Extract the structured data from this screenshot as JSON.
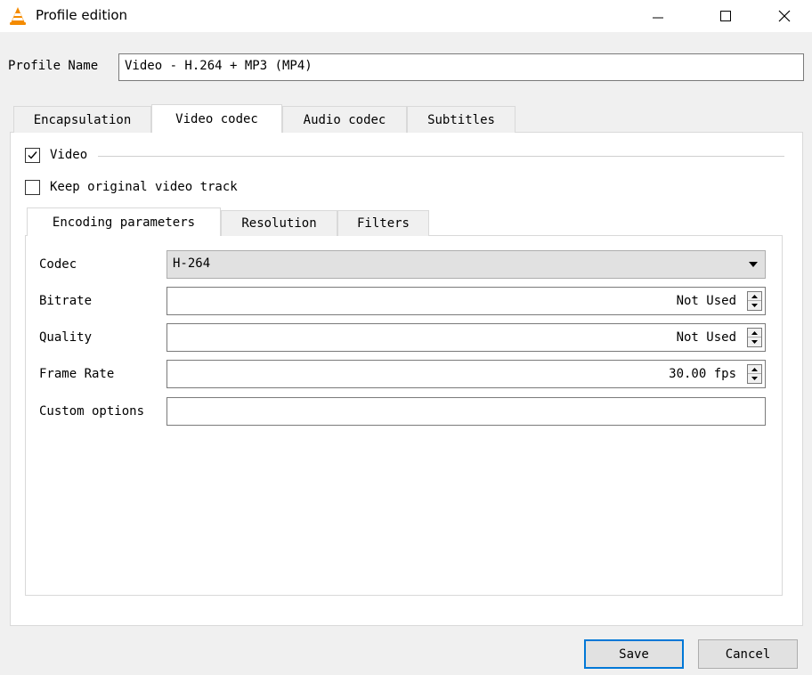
{
  "window": {
    "title": "Profile edition",
    "icon": "vlc-cone-icon",
    "controls": [
      "minimize-icon",
      "maximize-icon",
      "close-icon"
    ]
  },
  "profile": {
    "label": "Profile Name",
    "value": "Video - H.264 + MP3 (MP4)"
  },
  "tabs": [
    {
      "label": "Encapsulation",
      "active": false
    },
    {
      "label": "Video codec",
      "active": true
    },
    {
      "label": "Audio codec",
      "active": false
    },
    {
      "label": "Subtitles",
      "active": false
    }
  ],
  "video": {
    "video_checkbox": {
      "label": "Video",
      "checked": true
    },
    "keep_original": {
      "label": "Keep original video track",
      "checked": false
    },
    "subtabs": [
      {
        "label": "Encoding parameters",
        "active": true
      },
      {
        "label": "Resolution",
        "active": false
      },
      {
        "label": "Filters",
        "active": false
      }
    ],
    "fields": {
      "codec": {
        "label": "Codec",
        "value": "H-264"
      },
      "bitrate": {
        "label": "Bitrate",
        "value": "Not Used"
      },
      "quality": {
        "label": "Quality",
        "value": "Not Used"
      },
      "frame_rate": {
        "label": "Frame Rate",
        "value": "30.00 fps"
      },
      "custom_options": {
        "label": "Custom options",
        "value": ""
      }
    }
  },
  "buttons": {
    "save": "Save",
    "cancel": "Cancel"
  },
  "colors": {
    "accent": "#0078d7",
    "vlc_orange": "#f48b00"
  }
}
